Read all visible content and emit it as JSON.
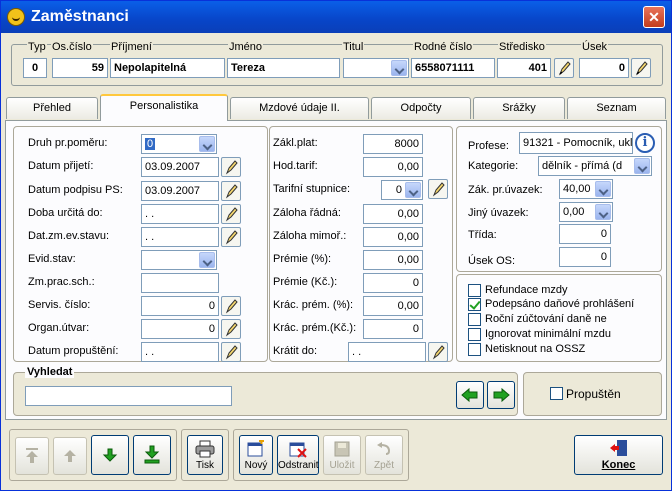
{
  "window": {
    "title": "Zaměstnanci",
    "close_glyph": "✕"
  },
  "header": {
    "labels": {
      "typ": "Typ",
      "os_cislo": "Os.číslo",
      "prijmeni": "Příjmení",
      "jmeno": "Jméno",
      "titul": "Titul",
      "rodne_cislo": "Rodné číslo",
      "stredisko": "Středisko",
      "usek": "Úsek"
    },
    "values": {
      "typ": "0",
      "os_cislo": "59",
      "prijmeni": "Nepolapitelná",
      "jmeno": "Tereza",
      "titul": "",
      "rodne_cislo": "6558071111",
      "stredisko": "401",
      "usek": "0"
    }
  },
  "tabs": [
    {
      "label": "Přehled",
      "active": false
    },
    {
      "label": "Personalistika",
      "active": true
    },
    {
      "label": "Mzdové údaje II.",
      "active": false
    },
    {
      "label": "Odpočty",
      "active": false
    },
    {
      "label": "Srážky",
      "active": false
    },
    {
      "label": "Seznam",
      "active": false
    }
  ],
  "personal": {
    "druh_pr_pomeru": {
      "label": "Druh pr.poměru:",
      "value": "0"
    },
    "datum_prijeti": {
      "label": "Datum přijetí:",
      "value": "03.09.2007"
    },
    "datum_podpisu": {
      "label": "Datum podpisu PS:",
      "value": "03.09.2007"
    },
    "doba_urcita": {
      "label": "Doba určitá do:",
      "value": " .  ."
    },
    "dat_zm_ev": {
      "label": "Dat.zm.ev.stavu:",
      "value": " .  ."
    },
    "evid_stav": {
      "label": "Evid.stav:",
      "value": ""
    },
    "zm_prac_sch": {
      "label": "Zm.prac.sch.:",
      "value": ""
    },
    "servis_cislo": {
      "label": "Servis. číslo:",
      "value": "0"
    },
    "organ_utvar": {
      "label": "Organ.útvar:",
      "value": "0"
    },
    "datum_propusteni": {
      "label": "Datum propuštění:",
      "value": " .  ."
    }
  },
  "pay": {
    "zakl_plat": {
      "label": "Zákl.plat:",
      "value": "8000"
    },
    "hod_tarif": {
      "label": "Hod.tarif:",
      "value": "0,00"
    },
    "tarifni_stupnice": {
      "label": "Tarifní stupnice:",
      "value": "0"
    },
    "zaloha_radna": {
      "label": "Záloha řádná:",
      "value": "0,00"
    },
    "zaloha_mimor": {
      "label": "Záloha mimoř.:",
      "value": "0,00"
    },
    "premie_pct": {
      "label": "Prémie (%):",
      "value": "0,00"
    },
    "premie_kc": {
      "label": "Prémie (Kč.):",
      "value": "0"
    },
    "krac_prem_pct": {
      "label": "Krác. prém. (%):",
      "value": "0,00"
    },
    "krac_prem_kc": {
      "label": "Krác. prém.(Kč.):",
      "value": "0"
    },
    "kratit_do": {
      "label": "Krátit do:",
      "value": " .  ."
    }
  },
  "profession": {
    "profese": {
      "label": "Profese:",
      "value": "91321  - Pomocník, uklí"
    },
    "kategorie": {
      "label": "Kategorie:",
      "value": "dělník - přímá (d"
    },
    "zak_pr_uvazek": {
      "label": "Zák. pr.úvazek:",
      "value": "40,00"
    },
    "jiny_uvazek": {
      "label": "Jiný úvazek:",
      "value": "0,00"
    },
    "trida": {
      "label": "Třída:",
      "value": "0"
    },
    "usek_os": {
      "label": "Úsek OS:",
      "value": "0"
    }
  },
  "checkboxes": [
    {
      "label": "Refundace mzdy",
      "checked": false
    },
    {
      "label": "Podepsáno daňové prohlášení",
      "checked": true
    },
    {
      "label": "Roční zúčtování daně ne",
      "checked": false
    },
    {
      "label": "Ignorovat minimální mzdu",
      "checked": false
    },
    {
      "label": "Netisknout na OSSZ",
      "checked": false
    }
  ],
  "search": {
    "label": "Vyhledat",
    "value": ""
  },
  "propusten": {
    "label": "Propuštěn",
    "checked": false
  },
  "toolbar": {
    "tisk": "Tisk",
    "novy": "Nový",
    "odstranit": "Odstranit",
    "ulozit": "Uložit",
    "zpet": "Zpět",
    "konec": "Konec"
  },
  "colors": {
    "titlebar": "#0a5fe8",
    "accent": "#ffc83c",
    "nav_arrow": "#21a121"
  }
}
